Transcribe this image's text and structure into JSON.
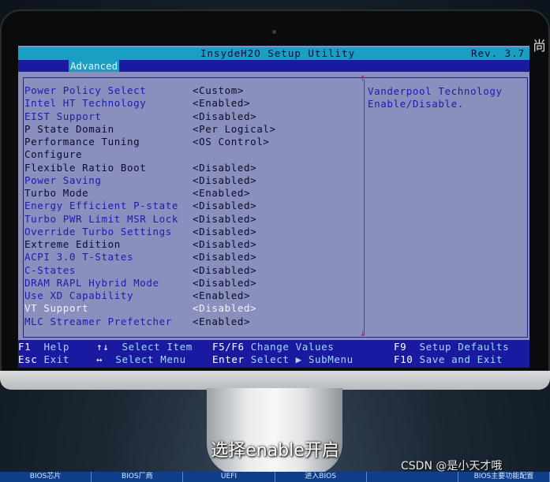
{
  "bios": {
    "title": "InsydeH2O Setup Utility",
    "revision": "Rev. 3.7",
    "active_tab": "Advanced",
    "settings": [
      {
        "label": "Power Policy Select",
        "value": "<Custom>",
        "style": "blue"
      },
      {
        "label": "Intel HT Technology",
        "value": "<Enabled>",
        "style": "blue"
      },
      {
        "label": "EIST Support",
        "value": "<Disabled>",
        "style": "blue"
      },
      {
        "label": "P State Domain",
        "value": "<Per Logical>",
        "style": "dark"
      },
      {
        "label": "Performance Tuning",
        "value": "<OS Control>",
        "style": "dark"
      },
      {
        "label": "Configure",
        "value": "",
        "style": "dark"
      },
      {
        "label": "Flexible Ratio Boot",
        "value": "<Disabled>",
        "style": "dark"
      },
      {
        "label": "Power Saving",
        "value": "<Disabled>",
        "style": "blue"
      },
      {
        "label": "Turbo Mode",
        "value": "<Enabled>",
        "style": "dark"
      },
      {
        "label": "Energy Efficient P-state",
        "value": "<Disabled>",
        "style": "blue"
      },
      {
        "label": "Turbo PWR Limit MSR Lock",
        "value": "<Disabled>",
        "style": "blue"
      },
      {
        "label": "Override Turbo Settings",
        "value": "<Disabled>",
        "style": "blue"
      },
      {
        "label": "Extreme Edition",
        "value": "<Disabled>",
        "style": "dark"
      },
      {
        "label": "ACPI 3.0 T-States",
        "value": "<Disabled>",
        "style": "blue"
      },
      {
        "label": "C-States",
        "value": "<Disabled>",
        "style": "blue"
      },
      {
        "label": "DRAM RAPL Hybrid Mode",
        "value": "<Disabled>",
        "style": "blue"
      },
      {
        "label": "Use XD Capability",
        "value": "<Enabled>",
        "style": "blue"
      },
      {
        "label": "VT Support",
        "value": "<Disabled>",
        "style": "selected"
      },
      {
        "label": "MLC Streamer Prefetcher",
        "value": "<Enabled>",
        "style": "blue"
      }
    ],
    "help": {
      "line1": "Vanderpool Technology",
      "line2": "Enable/Disable."
    },
    "footer": {
      "f1_key": "F1",
      "f1_desc": "Help",
      "esc_key": "Esc",
      "esc_desc": "Exit",
      "updown_key": "↑↓",
      "updown_desc": "Select Item",
      "leftright_key": "↔",
      "leftright_desc": "Select Menu",
      "f5f6_key": "F5/F6",
      "f5f6_desc": "Change Values",
      "enter_key": "Enter",
      "enter_desc": "Select ▶ SubMenu",
      "f9_key": "F9",
      "f9_desc": "Setup Defaults",
      "f10_key": "F10",
      "f10_desc": "Save and Exit"
    }
  },
  "overlay": {
    "side_glyph": "尚",
    "subtitle": "选择enable开启",
    "watermark": "CSDN @是小天才哦"
  },
  "bottom_nav": [
    "BIOS芯片",
    "BIOS厂商",
    "UEFI",
    "进入BIOS",
    "",
    "BIOS主要功能配置"
  ],
  "colors": {
    "bios_bg": "#8b8fbe",
    "bios_blue": "#1b1bb0",
    "bios_title": "#1a9ec4",
    "bios_bar": "#1a1aa0",
    "scroll_red": "#d01818"
  }
}
